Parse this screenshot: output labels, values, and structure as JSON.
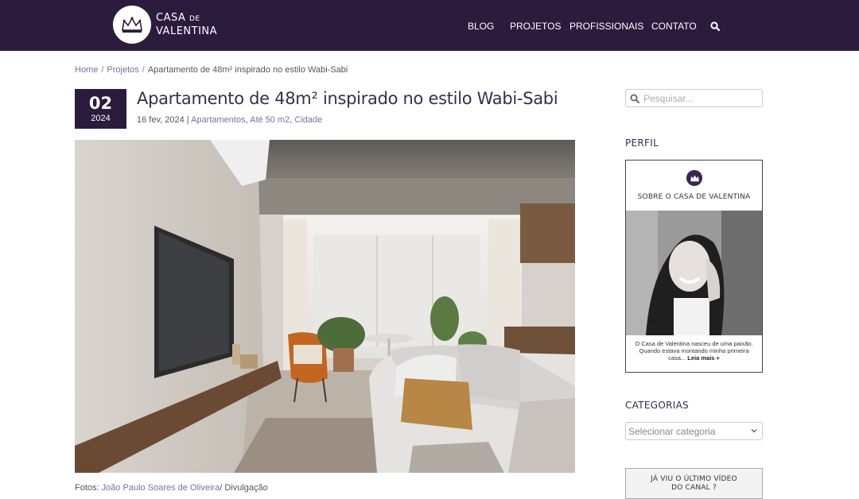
{
  "brand": {
    "line1": "CASA",
    "line1_small": "DE",
    "line2": "VALENTINA",
    "logo_icon": "crown-icon"
  },
  "nav": {
    "items": [
      "BLOG",
      "PROJETOS",
      "PROFISSIONAIS",
      "CONTATO"
    ],
    "search_icon": "search-icon"
  },
  "breadcrumb": {
    "home": "Home",
    "sep1": "/",
    "section": "Projetos",
    "sep2": "/",
    "current": "Apartamento de 48m² inspirado no estilo Wabi-Sabi"
  },
  "post": {
    "day": "02",
    "year": "2024",
    "title": "Apartamento de 48m² inspirado no estilo Wabi-Sabi",
    "date": "16 fev, 2024",
    "meta_sep": " | ",
    "categories": [
      "Apartamentos",
      "Até 50 m2",
      "Cidade"
    ],
    "credits_label": "Fotos: ",
    "credits_author": "João Paulo Soares de Oliveira",
    "credits_suffix": "/ Divulgação"
  },
  "sidebar": {
    "search_placeholder": "Pesquisar...",
    "profile_heading": "PERFIL",
    "profile_title": "SOBRE O CASA DE VALENTINA",
    "profile_text": "O Casa de Valentina nasceu de uma paixão. Quando estava montando minha primeira casa...",
    "profile_link": "Leia mais +",
    "categories_heading": "CATEGORIAS",
    "categories_select": "Selecionar categoria",
    "video_line1": "JÁ VIU O ÚLTIMO VÍDEO",
    "video_line2": "DO CANAL ?"
  },
  "colors": {
    "header_bg": "#2b1b3d",
    "link": "#6f74a6",
    "title": "#3a2d4d"
  }
}
